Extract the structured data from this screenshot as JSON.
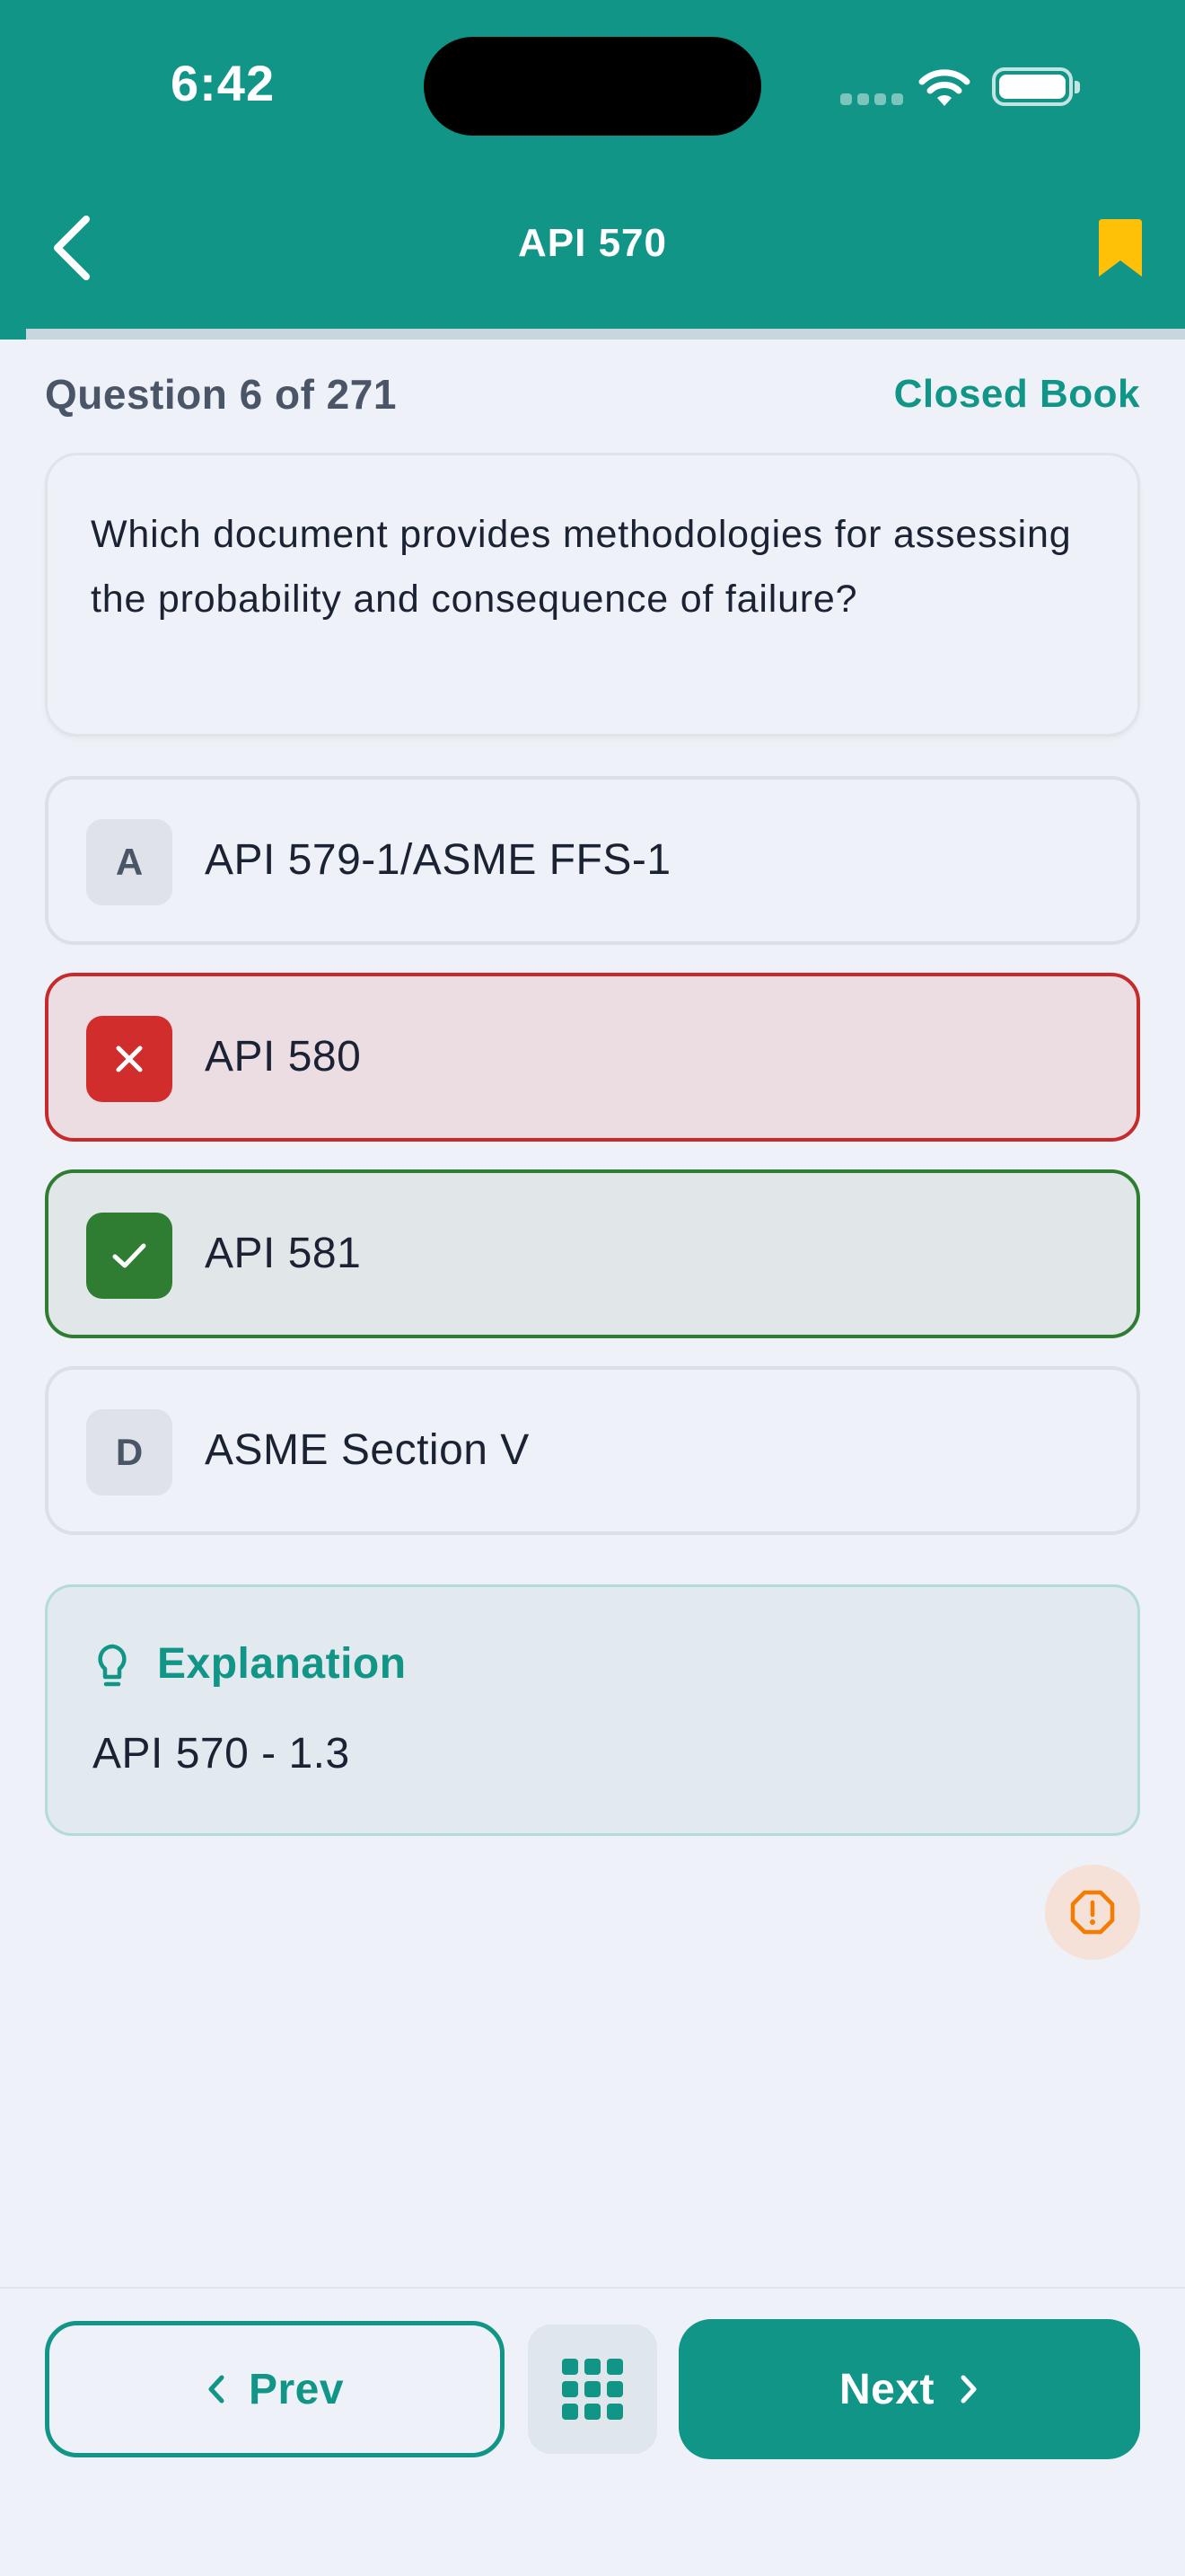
{
  "status_bar": {
    "time": "6:42"
  },
  "header": {
    "title": "API 570",
    "bookmark_color": "#FFC107"
  },
  "progress": {
    "current": 6,
    "total": 271
  },
  "question": {
    "counter": "Question 6 of 271",
    "mode": "Closed Book",
    "text": "Which document provides methodologies for assessing the probability and consequence of failure?"
  },
  "options": [
    {
      "letter": "A",
      "text": "API 579-1/ASME FFS-1",
      "state": "default"
    },
    {
      "letter": "B",
      "text": "API 580",
      "state": "incorrect",
      "icon": "x-icon"
    },
    {
      "letter": "C",
      "text": "API 581",
      "state": "correct",
      "icon": "check-icon"
    },
    {
      "letter": "D",
      "text": "ASME Section V",
      "state": "default"
    }
  ],
  "explanation": {
    "title": "Explanation",
    "body": "API 570 - 1.3",
    "icon": "lightbulb-icon"
  },
  "report": {
    "icon": "alert-octagon-icon"
  },
  "footer": {
    "prev_label": "Prev",
    "next_label": "Next",
    "grid_icon": "grid-icon"
  },
  "colors": {
    "primary": "#119587",
    "incorrect": "#D12D2D",
    "correct": "#2E7D32",
    "report": "#F57C00"
  }
}
